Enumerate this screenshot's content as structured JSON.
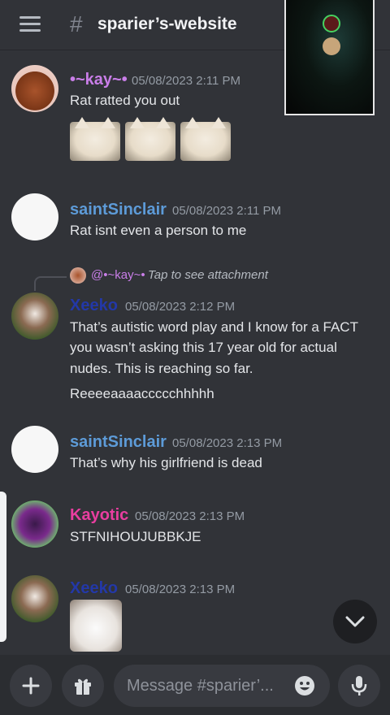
{
  "header": {
    "channel_prefix": "#",
    "channel_name": "sparier’s-website"
  },
  "messages": [
    {
      "author": "•~kay~•",
      "timestamp": "05/08/2023 2:11 PM",
      "lines": [
        "Rat ratted you out"
      ],
      "stickers": [
        "smudge-cat",
        "smudge-cat",
        "smudge-cat"
      ]
    },
    {
      "author": "saintSinclair",
      "timestamp": "05/08/2023 2:11 PM",
      "lines": [
        "Rat isnt even a person to me"
      ]
    },
    {
      "reply": {
        "author": "@•~kay~•",
        "text": "Tap to see attachment"
      },
      "author": "Xeeko",
      "timestamp": "05/08/2023 2:12 PM",
      "lines": [
        "That’s autistic word play and I know for a FACT",
        "you wasn’t asking this 17 year old for actual",
        "nudes. This is reaching so far."
      ],
      "followup": "Reeeeaaaaccccchhhhh"
    },
    {
      "author": "saintSinclair",
      "timestamp": "05/08/2023 2:13 PM",
      "lines": [
        "That’s why his girlfriend is dead"
      ]
    },
    {
      "author": "Kayotic",
      "timestamp": "05/08/2023 2:13 PM",
      "lines": [
        "STFNIHOUJUBBKJE"
      ]
    },
    {
      "author": "Xeeko",
      "timestamp": "05/08/2023 2:13 PM",
      "sticker": "screaming-cat"
    }
  ],
  "composer": {
    "placeholder": "Message #sparier’..."
  },
  "colors": {
    "background": "#313338",
    "kay": "#c97ee8",
    "saint": "#5d9bd8",
    "xeeko": "#2338a8",
    "kayotic": "#e93ea0"
  },
  "icons": [
    "hamburger-icon",
    "plus-icon",
    "gift-icon",
    "emoji-icon",
    "mic-icon",
    "chevron-down-icon"
  ]
}
